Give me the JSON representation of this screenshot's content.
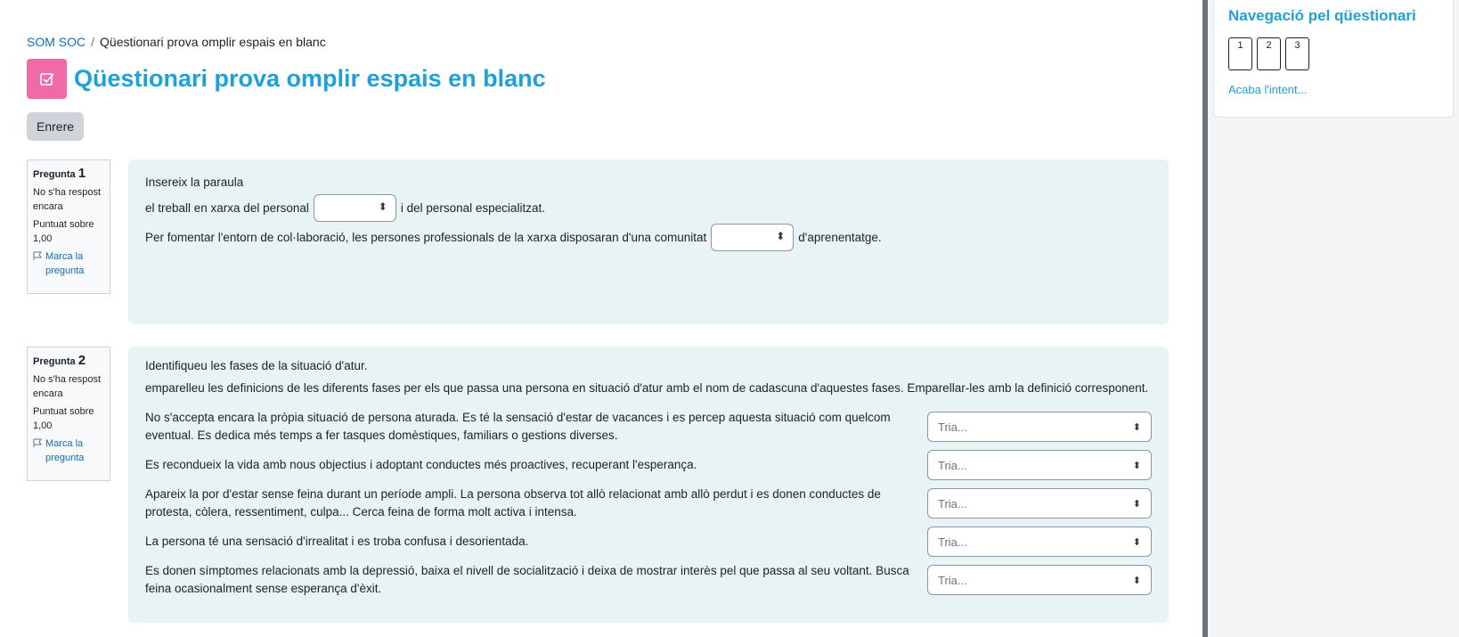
{
  "breadcrumb": {
    "course": "SOM SOC",
    "separator": "/",
    "current": "Qüestionari prova omplir espais en blanc"
  },
  "page_title": "Qüestionari prova omplir espais en blanc",
  "back_button": "Enrere",
  "questions": [
    {
      "label": "Pregunta",
      "number": "1",
      "state": "No s'ha respost encara",
      "grade": "Puntuat sobre 1,00",
      "flag": "Marca la pregunta",
      "intro": "Insereix la paraula",
      "line1_before": "el treball en xarxa del personal",
      "line1_after": "i del personal especialitzat.",
      "line2_before": "Per fomentar l'entorn de col·laboració, les persones professionals de la xarxa disposaran d'una comunitat",
      "line2_after": "d'aprenentatge."
    },
    {
      "label": "Pregunta",
      "number": "2",
      "state": "No s'ha respost encara",
      "grade": "Puntuat sobre 1,00",
      "flag": "Marca la pregunta",
      "intro": "Identifiqueu les fases de la situació d'atur.",
      "instruction": "emparelleu les definicions de les diferents fases per els que passa una persona en situació d'atur amb el nom de cadascuna d'aquestes fases. Emparellar-les amb la definició corresponent.",
      "select_placeholder": "Tria...",
      "items": [
        "No s'accepta encara la pròpia situació de persona aturada. Es té la sensació d'estar de vacances i es percep aquesta situació com quelcom eventual. Es dedica més temps a fer tasques domèstiques, familiars o gestions diverses.",
        "Es recondueix la vida amb nous objectius i adoptant conductes més proactives, recuperant l'esperança.",
        "Apareix la por d'estar sense feina durant un període ampli. La persona observa tot allò relacionat amb allò perdut i es donen conductes de protesta, còlera, ressentiment, culpa... Cerca feina de forma molt activa i intensa.",
        "La persona té una sensació d'irrealitat i es troba confusa i desorientada.",
        "Es donen símptomes relacionats amb la depressió, baixa el nivell de socialització i deixa de mostrar interès pel que passa al seu voltant. Busca feina ocasionalment sense esperança d'èxit."
      ]
    }
  ],
  "quiz_nav": {
    "title": "Navegació pel qüestionari",
    "buttons": [
      "1",
      "2",
      "3"
    ],
    "finish": "Acaba l'intent..."
  },
  "colors": {
    "accent": "#1ea1d9",
    "quiz_icon": "#f06aa8",
    "question_bg": "#e7f3f5"
  }
}
